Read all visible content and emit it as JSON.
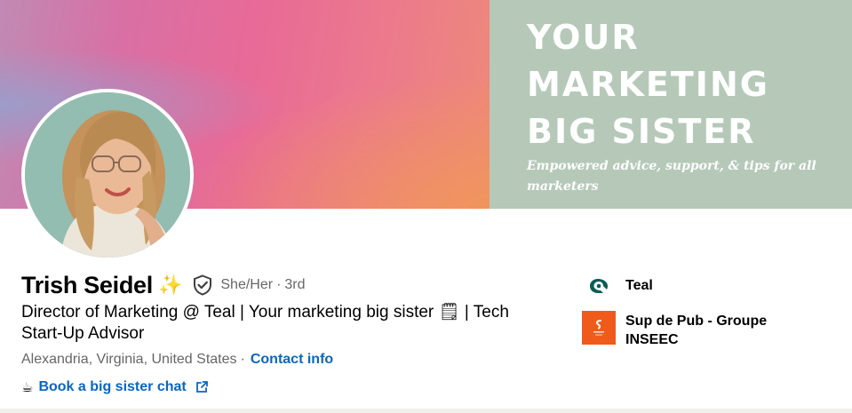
{
  "banner": {
    "headline_lines": [
      "YOUR",
      "MARKETING",
      "BIG SISTER"
    ],
    "tagline": "Empowered advice, support, & tips for all marketers",
    "panel_color": "#b6c9b9"
  },
  "profile": {
    "name": "Trish Seidel",
    "name_emoji": "✨",
    "verified_icon": "shield-check-icon",
    "pronouns": "She/Her",
    "separator": "·",
    "connection_degree": "3rd",
    "headline": "Director of Marketing @ Teal | Your marketing big sister 🗒 | Tech Start-Up Advisor",
    "location": "Alexandria, Virginia, United States",
    "location_separator": "·",
    "contact_info_label": "Contact info",
    "book_emoji": "☕",
    "book_link_label": "Book a big sister chat",
    "book_link_icon": "external-link-icon"
  },
  "companies": [
    {
      "name": "Teal",
      "logo_icon": "teal-logo-icon"
    },
    {
      "name": "Sup de Pub - Groupe INSEEC",
      "logo_icon": "sup-de-pub-logo-icon"
    }
  ],
  "colors": {
    "link": "#0a66c2",
    "secondary_text": "#666666",
    "teal_brand": "#0a5c55",
    "sup_de_pub_orange": "#f05a1a"
  }
}
